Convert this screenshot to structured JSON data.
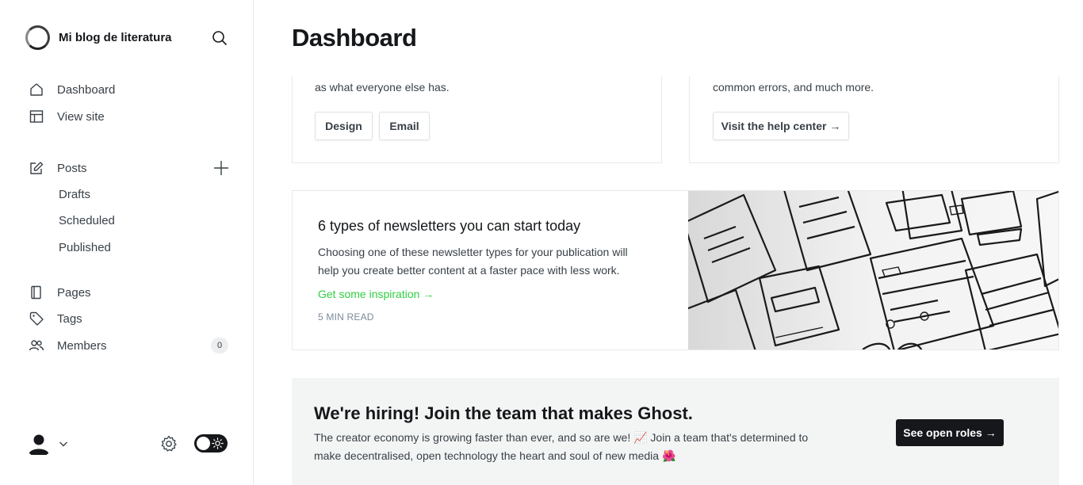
{
  "sidebar": {
    "site_name": "Mi blog de literatura",
    "nav": {
      "dashboard": "Dashboard",
      "view_site": "View site",
      "posts": "Posts",
      "drafts": "Drafts",
      "scheduled": "Scheduled",
      "published": "Published",
      "pages": "Pages",
      "tags": "Tags",
      "members": "Members",
      "members_count": "0"
    }
  },
  "header": {
    "title": "Dashboard"
  },
  "cards": {
    "left": {
      "text": "as what everyone else has.",
      "buttons": [
        "Design",
        "Email"
      ]
    },
    "right": {
      "text": "common errors, and much more.",
      "button": "Visit the help center →"
    }
  },
  "newsletter": {
    "title": "6 types of newsletters you can start today",
    "desc_line1": "Choosing one of these newsletter types for your publication will",
    "desc_line2": "help you create better content at a faster pace with less work.",
    "link": "Get some inspiration →",
    "meta": "5 MIN READ"
  },
  "hiring": {
    "title": "We're hiring! Join the team that makes Ghost.",
    "text_line1": "The creator economy is growing faster than ever, and so are we! 📈 Join a team that's determined to",
    "text_line2": "make decentralised, open technology the heart and soul of new media 🌺",
    "button": "See open roles →"
  },
  "colors": {
    "accent_green": "#30cf43",
    "dark": "#15171a",
    "hiring_bg": "#f3f5f4"
  }
}
